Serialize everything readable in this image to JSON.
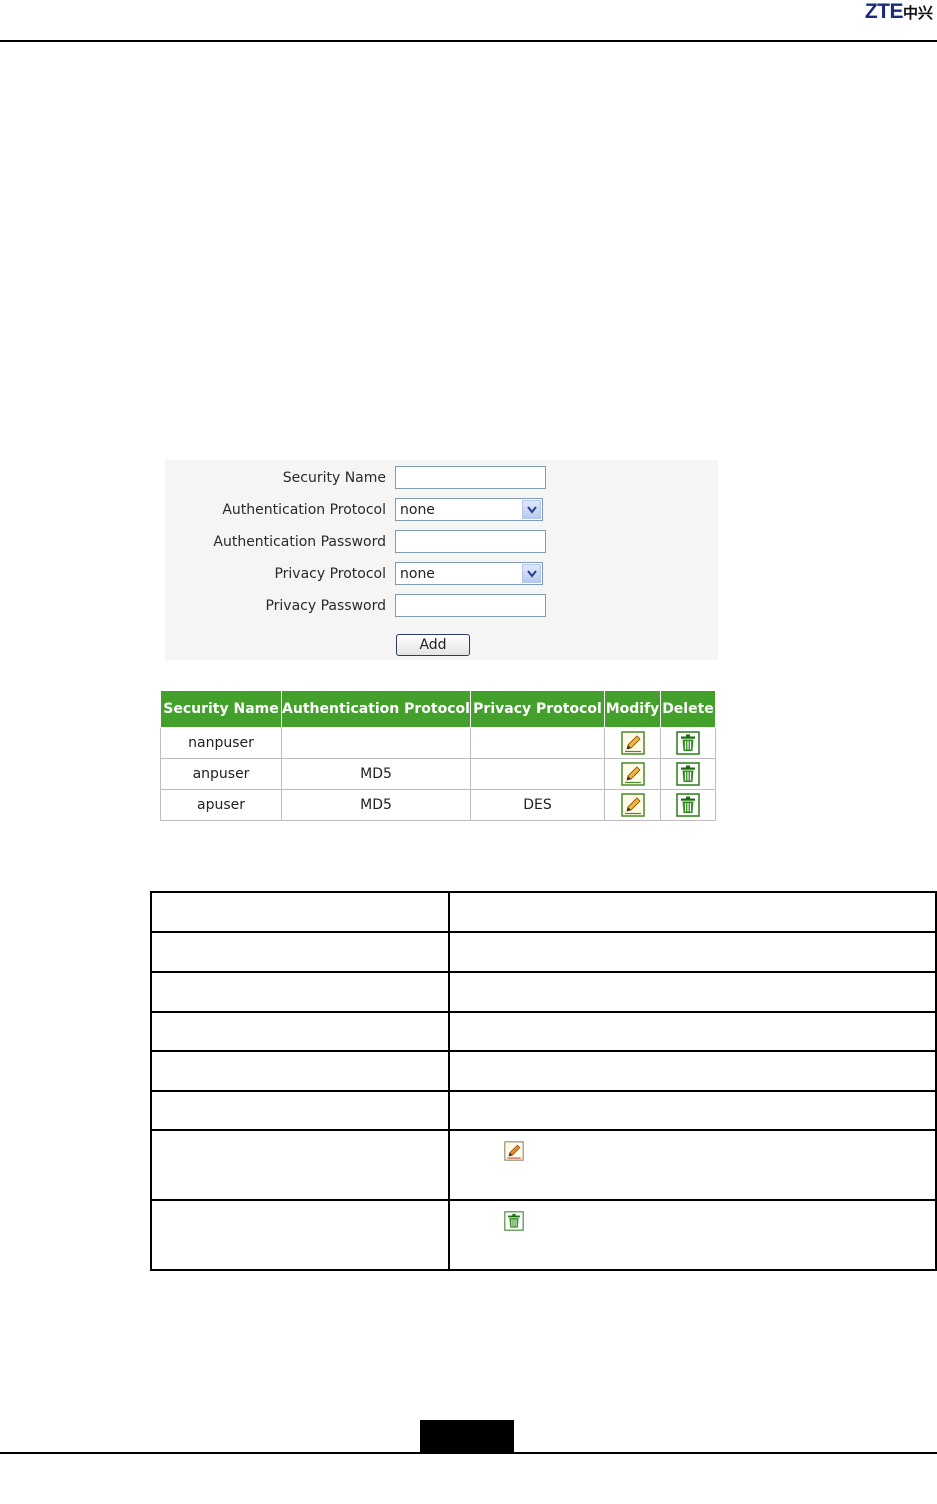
{
  "header": {
    "logo_latin": "ZTE",
    "logo_cn": "中兴"
  },
  "form": {
    "fields": [
      {
        "label": "Security Name",
        "type": "text",
        "value": ""
      },
      {
        "label": "Authentication Protocol",
        "type": "select",
        "value": "none"
      },
      {
        "label": "Authentication Password",
        "type": "text",
        "value": ""
      },
      {
        "label": "Privacy Protocol",
        "type": "select",
        "value": "none"
      },
      {
        "label": "Privacy Password",
        "type": "text",
        "value": ""
      }
    ],
    "add_label": "Add"
  },
  "user_table": {
    "headers": [
      "Security Name",
      "Authentication Protocol",
      "Privacy Protocol",
      "Modify",
      "Delete"
    ],
    "rows": [
      {
        "name": "nanpuser",
        "auth": "",
        "privacy": ""
      },
      {
        "name": "anpuser",
        "auth": "MD5",
        "privacy": ""
      },
      {
        "name": "apuser",
        "auth": "MD5",
        "privacy": "DES"
      }
    ]
  },
  "icons": {
    "modify": "pencil-edit-icon",
    "delete": "trash-delete-icon"
  },
  "colors": {
    "header_green": "#43a02a",
    "logo_blue": "#1a2b7a"
  }
}
